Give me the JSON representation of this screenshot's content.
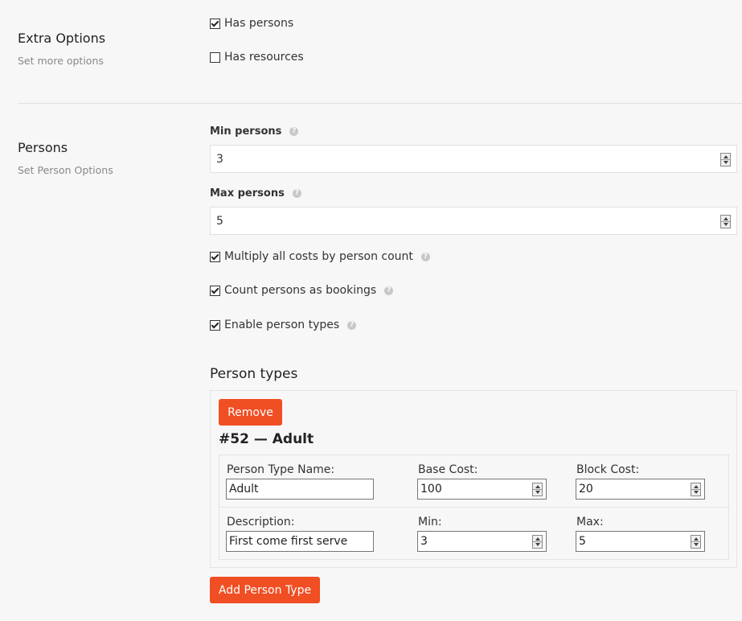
{
  "extra_options": {
    "title": "Extra Options",
    "subtitle": "Set more options",
    "has_persons": {
      "label": "Has persons",
      "checked": true
    },
    "has_resources": {
      "label": "Has resources",
      "checked": false
    }
  },
  "persons": {
    "title": "Persons",
    "subtitle": "Set Person Options",
    "min_persons": {
      "label": "Min persons",
      "value": "3"
    },
    "max_persons": {
      "label": "Max persons",
      "value": "5"
    },
    "multiply_costs": {
      "label": "Multiply all costs by person count",
      "checked": true
    },
    "count_as_bookings": {
      "label": "Count persons as bookings",
      "checked": true
    },
    "enable_person_types": {
      "label": "Enable person types",
      "checked": true
    },
    "help_glyph": "?"
  },
  "person_types": {
    "heading": "Person types",
    "remove_label": "Remove",
    "item_title": "#52 — Adult",
    "name_label": "Person Type Name:",
    "name_value": "Adult",
    "base_cost_label": "Base Cost:",
    "base_cost_value": "100",
    "block_cost_label": "Block Cost:",
    "block_cost_value": "20",
    "description_label": "Description:",
    "description_value": "First come first serve",
    "min_label": "Min:",
    "min_value": "3",
    "max_label": "Max:",
    "max_value": "5",
    "add_label": "Add Person Type"
  },
  "colors": {
    "accent": "#f04e23",
    "background": "#f7f7f7"
  }
}
